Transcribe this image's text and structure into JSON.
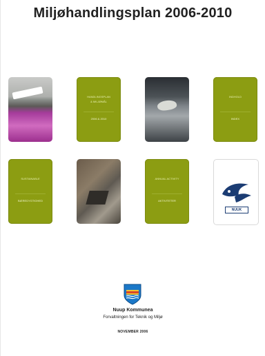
{
  "document": {
    "title": "Miljøhandlingsplan 2006-2010",
    "tiles": [
      {
        "type": "photo",
        "subject": "boat-and-purple-flowers"
      },
      {
        "type": "green",
        "line1": "HANDLINGSPLAN",
        "line2": "& MILJØMÅL",
        "line3": "2006 & 2010"
      },
      {
        "type": "photo",
        "subject": "bird-on-post"
      },
      {
        "type": "green",
        "line1": "INDHOLD",
        "line2": "",
        "line3": "INDEX"
      },
      {
        "type": "green",
        "line1": "SUSTAINABLE",
        "line2": "",
        "line3": "BÆREDYGTIGHED"
      },
      {
        "type": "photo",
        "subject": "house-from-above"
      },
      {
        "type": "green",
        "line1": "ANNUAL ACTIVITY",
        "line2": "",
        "line3": "AKTIVITETER"
      },
      {
        "type": "logo",
        "logo_text": "NUUK"
      }
    ],
    "organization": {
      "name": "Nuup Kommunea",
      "department": "Forvaltningen for Teknik og Miljø",
      "date": "NOVEMBER 2006"
    },
    "colors": {
      "tile_green": "#8c9d12",
      "logo_blue": "#1b3c73"
    }
  }
}
